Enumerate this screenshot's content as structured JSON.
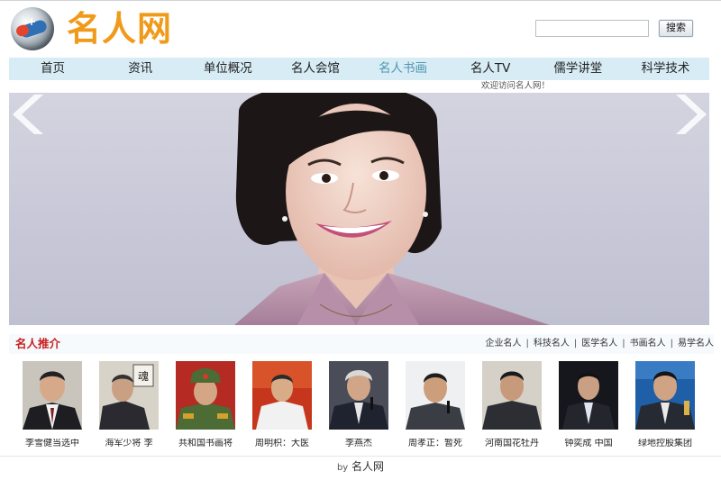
{
  "header": {
    "logo_text": "名人网",
    "search": {
      "value": "",
      "placeholder": ""
    },
    "search_button": "搜索"
  },
  "nav": {
    "items": [
      {
        "label": "首页"
      },
      {
        "label": "资讯"
      },
      {
        "label": "单位概况"
      },
      {
        "label": "名人会馆"
      },
      {
        "label": "名人书画",
        "active": true
      },
      {
        "label": "名人TV"
      },
      {
        "label": "儒学讲堂"
      },
      {
        "label": "科学技术"
      }
    ],
    "active_color": "#4f97b0",
    "background": "#d8ecf5"
  },
  "welcome_text": "欢迎访问名人网！",
  "banner": {
    "prev_icon": "chevron-left-icon",
    "next_icon": "chevron-right-icon"
  },
  "section": {
    "title": "名人推介",
    "title_color": "#c82121",
    "categories": [
      "企业名人",
      "科技名人",
      "医学名人",
      "书画名人",
      "易学名人"
    ]
  },
  "people": [
    {
      "name": "李雪健当选中"
    },
    {
      "name": "海军少将 李"
    },
    {
      "name": "共和国书画将"
    },
    {
      "name": "周明枳：大医"
    },
    {
      "name": "李燕杰"
    },
    {
      "name": "周孝正：暂死"
    },
    {
      "name": "河南国花牡丹"
    },
    {
      "name": "钟奕成 中国"
    },
    {
      "name": "绿地控股集团"
    }
  ],
  "footer": {
    "by": "by",
    "site": "名人网"
  }
}
